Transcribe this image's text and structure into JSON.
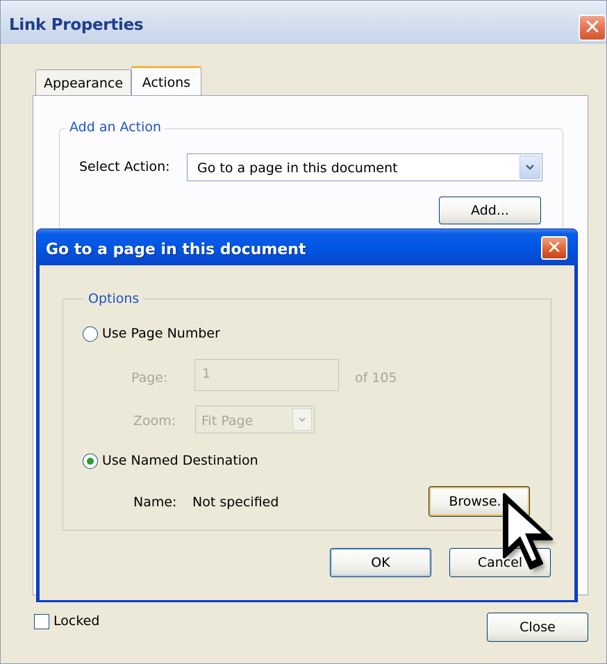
{
  "link_properties": {
    "title": "Link Properties",
    "close_glyph": "✕",
    "tabs": [
      {
        "label": "Appearance",
        "selected": false
      },
      {
        "label": "Actions",
        "selected": true
      }
    ],
    "add_action": {
      "legend": "Add an Action",
      "select_action_label": "Select Action:",
      "select_action_value": "Go to a page in this document",
      "add_button": "Add..."
    },
    "locked_label": "Locked",
    "locked_checked": false,
    "close_button": "Close"
  },
  "goto_dialog": {
    "title": "Go to a page in this document",
    "close_glyph": "✕",
    "options_legend": "Options",
    "use_page_number": {
      "label": "Use Page Number",
      "selected": false
    },
    "page_label": "Page:",
    "page_value": "1",
    "of_pages": "of 105",
    "zoom_label": "Zoom:",
    "zoom_value": "Fit Page",
    "use_named_destination": {
      "label": "Use Named Destination",
      "selected": true
    },
    "name_label": "Name:",
    "name_value": "Not specified",
    "browse_button": "Browse...",
    "ok_button": "OK",
    "cancel_button": "Cancel"
  },
  "icons": {
    "dropdown": "chevron-down-icon",
    "cursor": "mouse-pointer-icon"
  },
  "colors": {
    "dialog_title_blue": "#0054e3",
    "legend_blue": "#1f52c4",
    "close_red": "#e06233",
    "window_bg": "#ece9d8"
  }
}
